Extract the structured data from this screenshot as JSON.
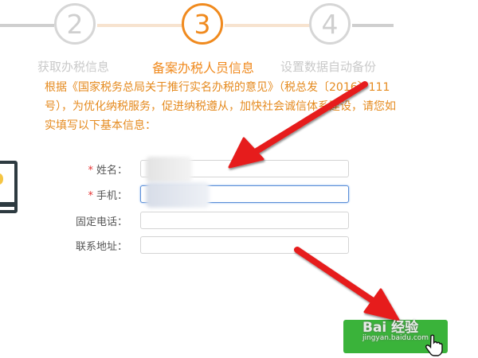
{
  "steps": [
    {
      "number": "2",
      "label": "获取办税信息",
      "state": "done"
    },
    {
      "number": "3",
      "label": "备案办税人员信息",
      "state": "active"
    },
    {
      "number": "4",
      "label": "设置数据自动备份",
      "state": "pending"
    }
  ],
  "notice": "根据《国家税务总局关于推行实名办税的意见》（税总发〔2016〕111号），为优化纳税服务，促进纳税遵从，加快社会诚信体系建设，请您如实填写以下基本信息：",
  "form": {
    "required_mark": "*",
    "name_label": "姓名：",
    "phone_label": "手机：",
    "landline_label": "固定电话：",
    "address_label": "联系地址："
  },
  "watermark": {
    "brand": "Bai 经验",
    "url": "jingyan.baidu.com"
  },
  "colors": {
    "active": "#f08a1e",
    "inactive": "#cfcfcf",
    "arrow": "#e61e1e",
    "button": "#3ab33a",
    "required": "#e53333"
  },
  "icons": [
    "arrow-annotation",
    "hand-pointer-cursor"
  ]
}
